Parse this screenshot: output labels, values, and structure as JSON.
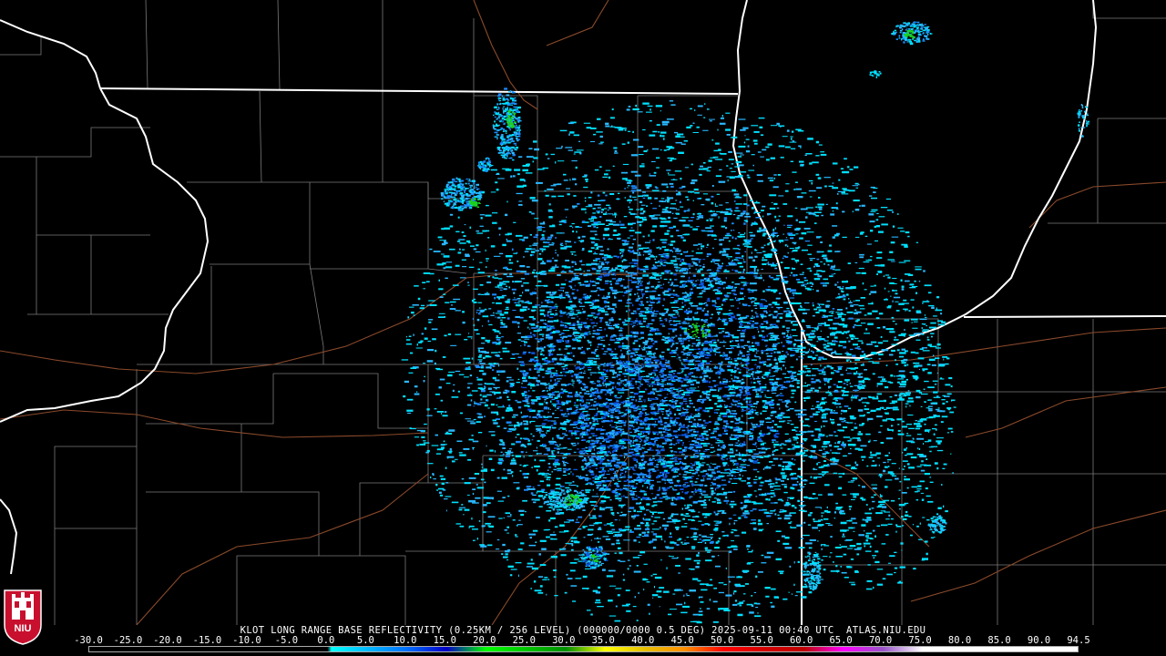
{
  "caption": "KLOT LONG RANGE BASE REFLECTIVITY (0.25KM / 256 LEVEL) (000000/0000 0.5 DEG) 2025-09-11 00:40 UTC  ATLAS.NIU.EDU",
  "colorbar": {
    "labels": [
      "-30.0",
      "-25.0",
      "-20.0",
      "-15.0",
      "-10.0",
      "-5.0",
      "0.0",
      "5.0",
      "10.0",
      "15.0",
      "20.0",
      "25.0",
      "30.0",
      "35.0",
      "40.0",
      "45.0",
      "50.0",
      "55.0",
      "60.0",
      "65.0",
      "70.0",
      "75.0",
      "80.0",
      "85.0",
      "90.0",
      "94.5"
    ],
    "min_dbz": -30,
    "max_dbz": 94.5,
    "stops": [
      {
        "dbz": -30,
        "color": "#000000"
      },
      {
        "dbz": 0,
        "color": "#000000"
      },
      {
        "dbz": 0.5,
        "color": "#00ffff"
      },
      {
        "dbz": 10,
        "color": "#0070ff"
      },
      {
        "dbz": 15,
        "color": "#0000c8"
      },
      {
        "dbz": 20,
        "color": "#00ff00"
      },
      {
        "dbz": 25,
        "color": "#00c800"
      },
      {
        "dbz": 30,
        "color": "#009000"
      },
      {
        "dbz": 35,
        "color": "#ffff00"
      },
      {
        "dbz": 40,
        "color": "#e7c000"
      },
      {
        "dbz": 45,
        "color": "#ff9000"
      },
      {
        "dbz": 50,
        "color": "#ff0000"
      },
      {
        "dbz": 55,
        "color": "#d60000"
      },
      {
        "dbz": 60,
        "color": "#c00000"
      },
      {
        "dbz": 65,
        "color": "#ff00ff"
      },
      {
        "dbz": 70,
        "color": "#9955c9"
      },
      {
        "dbz": 75,
        "color": "#ffffff"
      },
      {
        "dbz": 94.5,
        "color": "#ffffff"
      }
    ]
  },
  "map": {
    "background": "#000000",
    "state_border_color": "#ffffff",
    "county_line_color": "#7a7a7a",
    "road_color": "#8b4a2b",
    "echo_colors": [
      "#00e0ff",
      "#29b8ff",
      "#1a8cff",
      "#0a55e0",
      "#1ad11a"
    ]
  },
  "logo": {
    "text": "NIU",
    "color": "#c8102e"
  }
}
